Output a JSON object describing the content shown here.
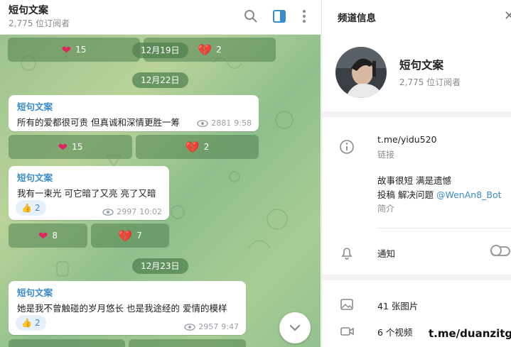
{
  "chat": {
    "title": "短句文案",
    "subscribers": "2,775 位订阅者",
    "icons": [
      "search-icon",
      "sidebar-toggle-icon",
      "more-vertical-icon"
    ],
    "reactions_top": [
      {
        "emoji": "❤️",
        "count": "15"
      },
      {
        "emoji": "💔",
        "count": "2"
      }
    ],
    "dates": [
      "12月19日",
      "12月22日",
      "12月23日"
    ],
    "messages": [
      {
        "sender": "短句文案",
        "text": "所有的爱都很可贵 但真诚和深情更胜一筹",
        "views": "2881",
        "time": "9:58",
        "reactions": [
          {
            "emoji": "❤️",
            "count": "15"
          },
          {
            "emoji": "💔",
            "count": "2"
          }
        ]
      },
      {
        "sender": "短句文案",
        "text": "我有一束光 可它暗了又亮 亮了又暗",
        "like": "2",
        "views": "2997",
        "time": "10:02",
        "reactions": [
          {
            "emoji": "❤️",
            "count": "8"
          },
          {
            "emoji": "💔",
            "count": "7"
          }
        ]
      },
      {
        "sender": "短句文案",
        "text": "她是我不曾触碰的岁月悠长 也是我途经的 爱情的模样",
        "like": "2",
        "views": "2957",
        "time": "9:47"
      }
    ]
  },
  "info": {
    "header": "频道信息",
    "name": "短句文案",
    "subscribers": "2,775 位订阅者",
    "link": "t.me/yidu520",
    "link_label": "链接",
    "desc_line1": "故事很短 满是遗憾",
    "desc_line2_prefix": "投稿 解决问题 ",
    "desc_bot": "@WenAn8_Bot",
    "desc_label": "简介",
    "notify": "通知",
    "photos": "41 张图片",
    "videos": "6 个视频"
  },
  "watermark": "t.me/duanzitg",
  "colors": {
    "accent": "#3a8bc9",
    "reaction_bg": "#5a8a58",
    "heart": "#e0245e"
  }
}
